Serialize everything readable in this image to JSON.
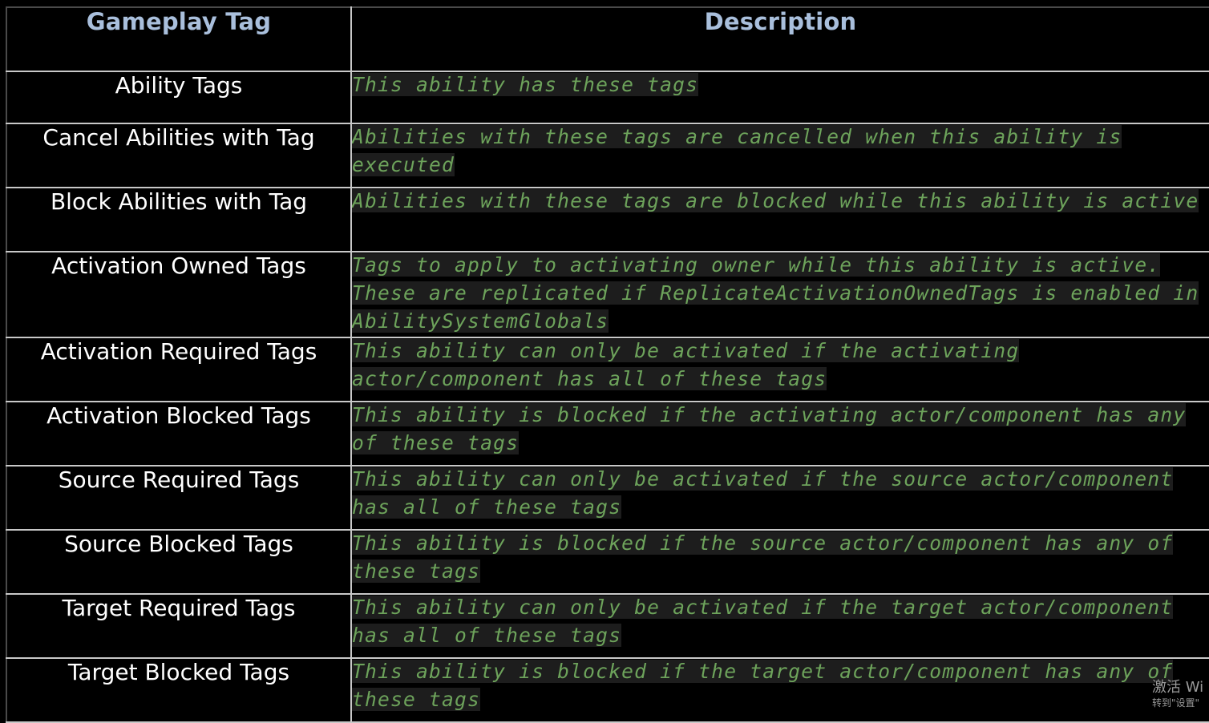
{
  "table": {
    "headers": [
      "Gameplay Tag",
      "Description"
    ],
    "rows": [
      {
        "tag": "Ability Tags",
        "description": "This ability has these tags"
      },
      {
        "tag": "Cancel Abilities with Tag",
        "description": "Abilities with these tags are cancelled when this ability is executed"
      },
      {
        "tag": "Block Abilities with Tag",
        "description": "Abilities with these tags are blocked while this ability is active"
      },
      {
        "tag": "Activation Owned Tags",
        "description": "Tags to apply to activating owner while this ability is active. These are replicated if ReplicateActivationOwnedTags is enabled in AbilitySystemGlobals"
      },
      {
        "tag": "Activation Required Tags",
        "description": "This ability can only be activated if the activating actor/component has all of these tags"
      },
      {
        "tag": "Activation Blocked Tags",
        "description": "This ability is blocked if the activating actor/component has any of these tags"
      },
      {
        "tag": "Source Required Tags",
        "description": "This ability can only be activated if the source actor/component has all of these tags"
      },
      {
        "tag": "Source Blocked Tags",
        "description": "This ability is blocked if the source actor/component has any of these tags"
      },
      {
        "tag": "Target Required Tags",
        "description": "This ability can only be activated if the target actor/component has all of these tags"
      },
      {
        "tag": "Target Blocked Tags",
        "description": "This ability is blocked if the target actor/component has any of these tags"
      }
    ]
  },
  "watermark": {
    "line1": "激活 Wi",
    "line2": "转到\"设置\""
  },
  "colors": {
    "header_text": "#a9bfdc",
    "tag_text": "#ffffff",
    "description_text": "#6da35b",
    "description_highlight": "#1d1d1d",
    "background": "#000000",
    "grid_lines": "#c8c8c8"
  }
}
